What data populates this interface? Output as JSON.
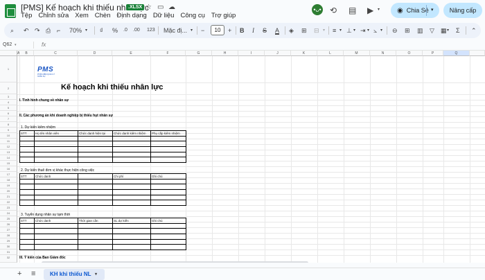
{
  "header": {
    "title": "[PMS] Kế hoạch khi thiếu nhân lực",
    "file_badge": ".XLSX",
    "menu": [
      "Tệp",
      "Chỉnh sửa",
      "Xem",
      "Chèn",
      "Định dạng",
      "Dữ liệu",
      "Công cụ",
      "Trợ giúp"
    ],
    "share_label": "Chia Sẻ",
    "upgrade_label": "Nâng cấp"
  },
  "toolbar": {
    "zoom": "70%",
    "currency": "₫",
    "percent": "%",
    "decimal_decrease": ".0",
    "decimal_increase": ".00",
    "number_format": "123",
    "font": "Mặc đị...",
    "font_size": "10"
  },
  "formula_bar": {
    "cell_ref": "Q62",
    "fx": "fx"
  },
  "grid": {
    "columns": [
      "A",
      "B",
      "C",
      "D",
      "E",
      "F",
      "G",
      "H",
      "I",
      "J",
      "K",
      "L",
      "M",
      "N",
      "O",
      "P",
      "Q"
    ],
    "rows": [
      "1",
      "2",
      "3",
      "4",
      "5",
      "6",
      "7",
      "8",
      "9",
      "10",
      "11",
      "12",
      "13",
      "14",
      "15",
      "16",
      "17",
      "18",
      "19",
      "20",
      "21",
      "22",
      "23",
      "24",
      "25",
      "26",
      "27",
      "28",
      "29",
      "30",
      "31",
      "32"
    ]
  },
  "sheet": {
    "logo_text": "PMS",
    "logo_sub": "PHẦN MỀM QUẢN LÝ NHÂN SỰ",
    "title": "Kế hoạch khi thiếu nhân lực",
    "section1": "I. Tình hình chung về nhân sự",
    "section2": "II. Các phương án khi doanh nghiệp bị thiếu hụt nhân sự",
    "sub1": "1. Dự kiến kiêm nhiệm",
    "table1_headers": [
      "STT",
      "Họ tên nhân viên",
      "Chức danh hiện tại",
      "Chức danh kiêm nhiệm",
      "Phụ cấp kiêm nhiệm"
    ],
    "sub2": "2. Dự kiến thuê đơn vị khác thực hiện công việc",
    "table2_headers": [
      "STT",
      "Chức danh",
      "",
      "Chi phí",
      "Ghi chú"
    ],
    "sub3": "3. Tuyển dụng nhân sự tạm thời",
    "table3_headers": [
      "STT",
      "Chức danh",
      "Thời gian cần",
      "SL dự kiến",
      "Ghi chú"
    ],
    "section3": "III. Ý kiến của Ban Giám đốc"
  },
  "bottom": {
    "sheet_tab": "KH khi thiếu NL"
  }
}
